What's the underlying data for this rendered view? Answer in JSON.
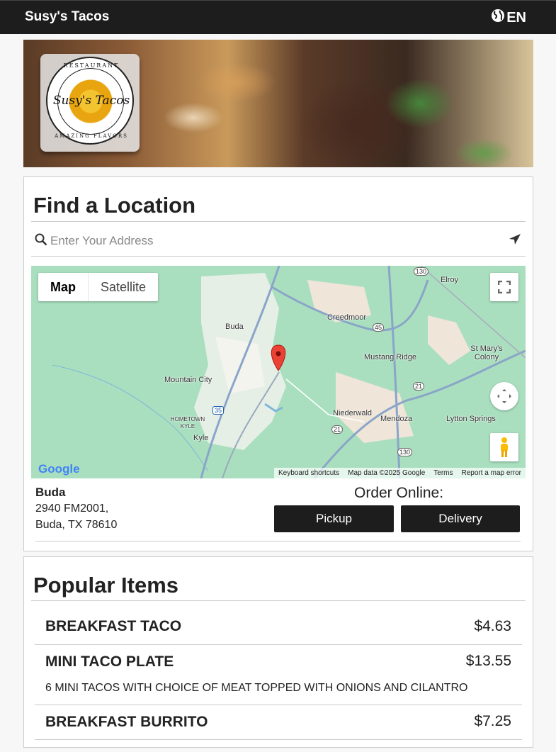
{
  "header": {
    "brand": "Susy's Tacos",
    "language": "EN"
  },
  "logo": {
    "ring_top": "RESTAURANT",
    "name": "Susy's Tacos",
    "ring_bottom": "AMAZING FLAVORS"
  },
  "find_location": {
    "title": "Find a Location",
    "search_placeholder": "Enter Your Address",
    "map": {
      "type_buttons": [
        "Map",
        "Satellite"
      ],
      "place_labels": [
        "Buda",
        "Creedmoor",
        "Elroy",
        "Mustang Ridge",
        "St Mary's Colony",
        "Mountain City",
        "Niederwald",
        "Mendoza",
        "Lytton Springs",
        "HOMETOWN KYLE",
        "Kyle"
      ],
      "highway_labels": [
        "130",
        "45",
        "21",
        "35",
        "21",
        "130"
      ],
      "google_logo": "Google",
      "attribution": [
        "Keyboard shortcuts",
        "Map data ©2025 Google",
        "Terms",
        "Report a map error"
      ]
    },
    "location": {
      "name": "Buda",
      "address_line1": "2940 FM2001,",
      "address_line2": "Buda, TX 78610"
    },
    "order": {
      "title": "Order Online:",
      "pickup": "Pickup",
      "delivery": "Delivery"
    }
  },
  "popular": {
    "title": "Popular Items",
    "items": [
      {
        "name": "BREAKFAST TACO",
        "price": "$4.63",
        "description": ""
      },
      {
        "name": "MINI TACO PLATE",
        "price": "$13.55",
        "description": "6 MINI TACOS WITH CHOICE OF MEAT TOPPED WITH ONIONS AND CILANTRO"
      },
      {
        "name": "BREAKFAST BURRITO",
        "price": "$7.25",
        "description": ""
      }
    ]
  }
}
